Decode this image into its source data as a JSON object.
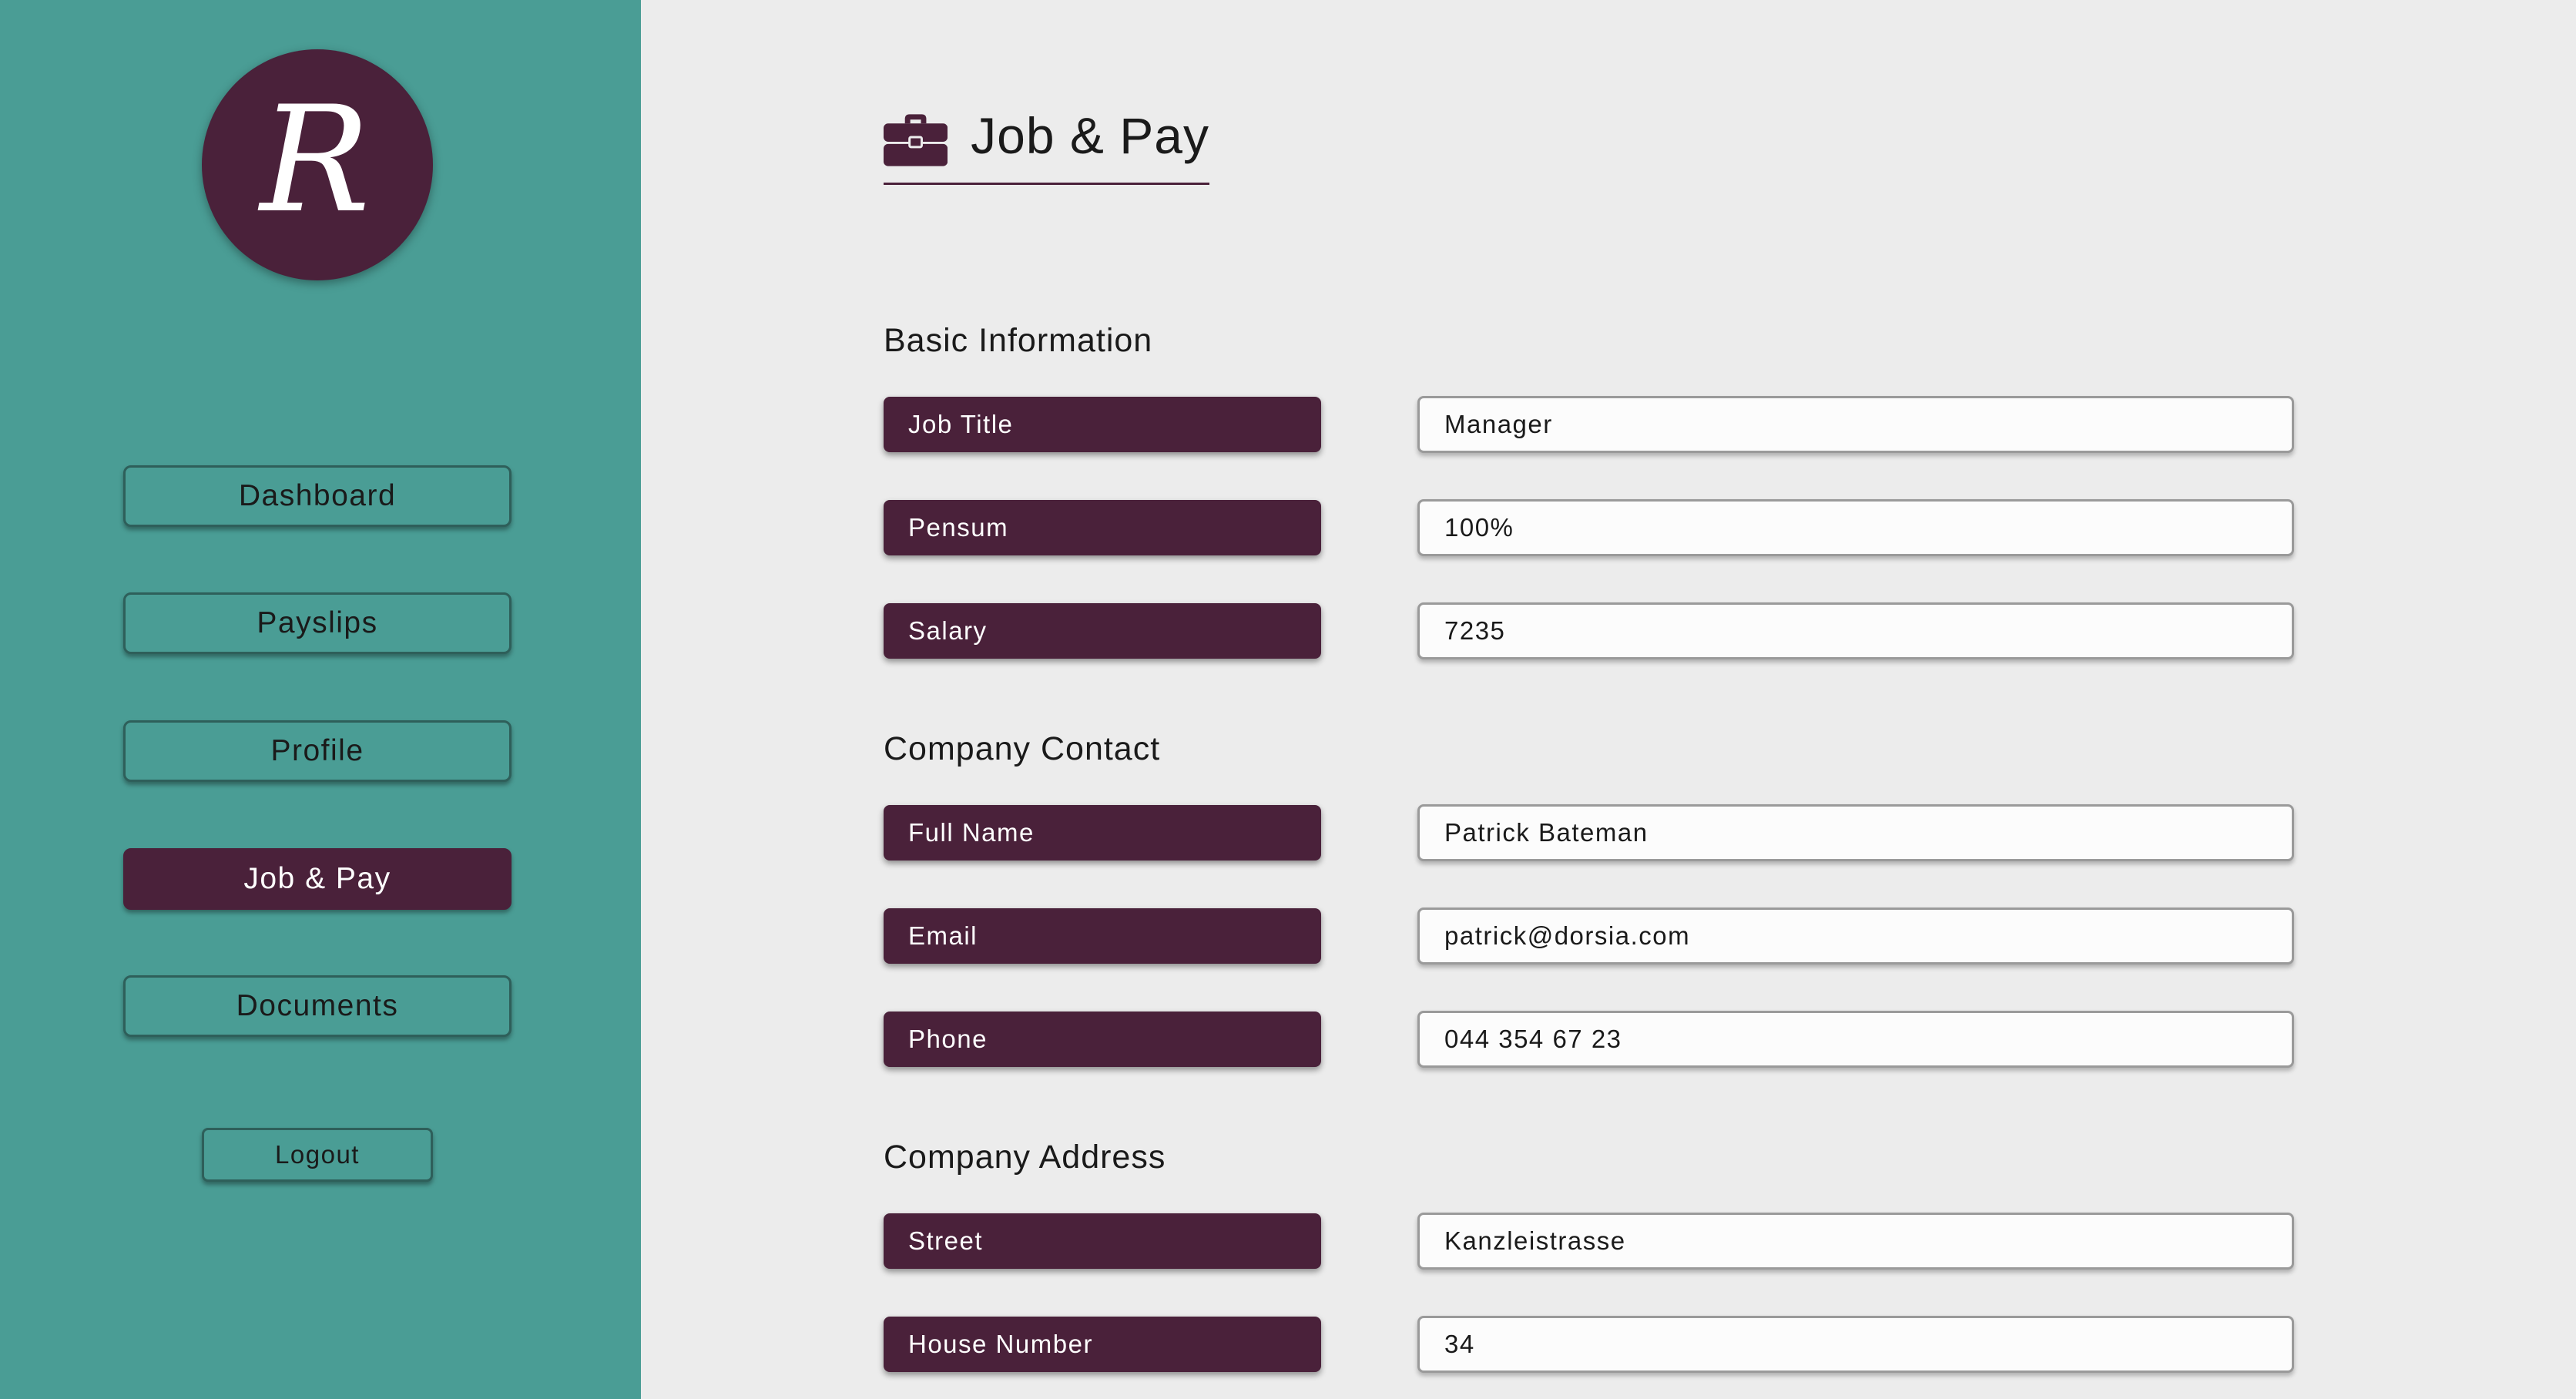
{
  "brand": {
    "logo_letter": "R",
    "accent_color": "#4a213a",
    "sidebar_color": "#4a9d95",
    "background_color": "#ececec"
  },
  "sidebar": {
    "items": [
      {
        "label": "Dashboard",
        "active": false
      },
      {
        "label": "Payslips",
        "active": false
      },
      {
        "label": "Profile",
        "active": false
      },
      {
        "label": "Job & Pay",
        "active": true
      },
      {
        "label": "Documents",
        "active": false
      }
    ],
    "logout_label": "Logout"
  },
  "header": {
    "icon": "briefcase-icon",
    "title": "Job & Pay"
  },
  "sections": {
    "basic": {
      "title": "Basic Information",
      "fields": [
        {
          "label": "Job Title",
          "value": "Manager"
        },
        {
          "label": "Pensum",
          "value": "100%"
        },
        {
          "label": "Salary",
          "value": "7235"
        }
      ]
    },
    "contact": {
      "title": "Company Contact",
      "fields": [
        {
          "label": "Full Name",
          "value": "Patrick Bateman"
        },
        {
          "label": "Email",
          "value": "patrick@dorsia.com"
        },
        {
          "label": "Phone",
          "value": "044 354 67 23"
        }
      ]
    },
    "address": {
      "title": "Company Address",
      "fields": [
        {
          "label": "Street",
          "value": "Kanzleistrasse"
        },
        {
          "label": "House Number",
          "value": "34"
        }
      ]
    }
  }
}
